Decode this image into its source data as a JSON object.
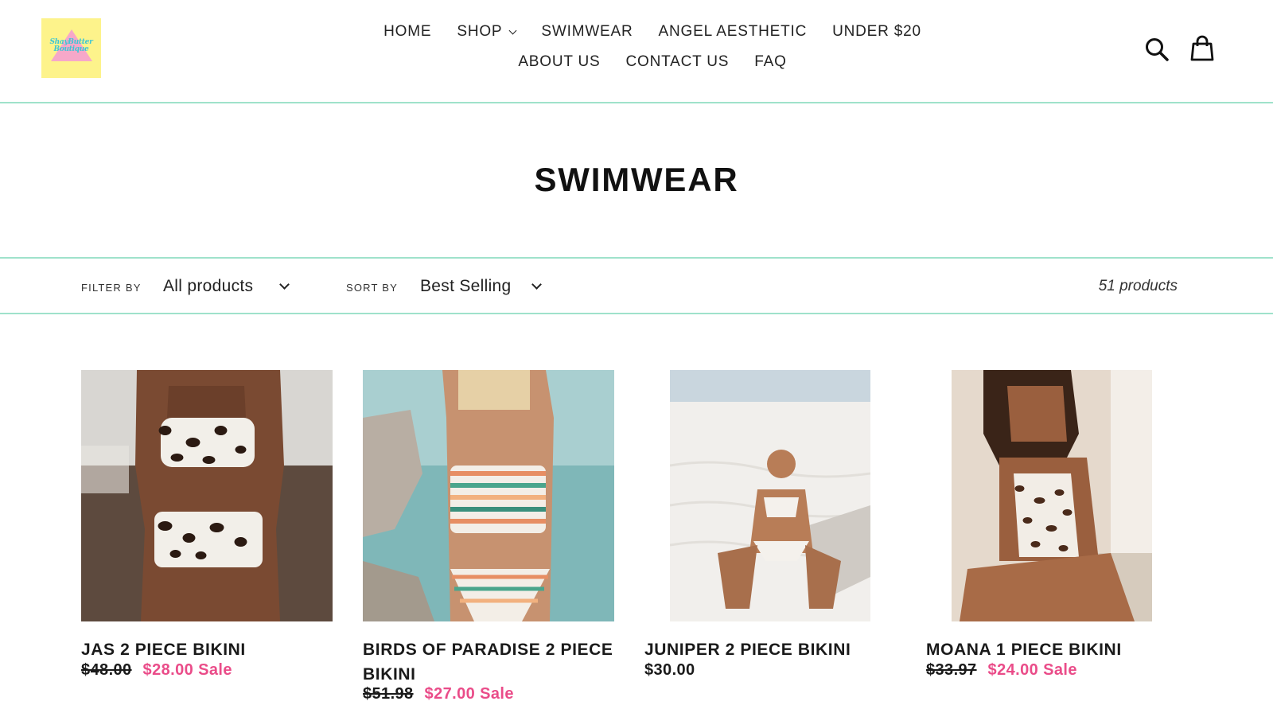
{
  "brand": {
    "logo_text": "ShayButter Boutique",
    "accent_color": "#9fe2cb",
    "sale_color": "#ea4c89"
  },
  "nav": {
    "row1": [
      {
        "label": "HOME"
      },
      {
        "label": "SHOP",
        "dropdown": true
      },
      {
        "label": "SWIMWEAR"
      },
      {
        "label": "ANGEL AESTHETIC"
      },
      {
        "label": "UNDER $20"
      }
    ],
    "row2": [
      {
        "label": "ABOUT US"
      },
      {
        "label": "CONTACT US"
      },
      {
        "label": "FAQ"
      }
    ]
  },
  "header_icons": {
    "search": "search-icon",
    "cart": "cart-icon"
  },
  "page": {
    "title": "SWIMWEAR"
  },
  "filters": {
    "filter_label": "FILTER BY",
    "filter_value": "All products",
    "sort_label": "SORT BY",
    "sort_value": "Best Selling",
    "count": "51 products"
  },
  "products": [
    {
      "title": "JAS 2 PIECE BIKINI",
      "compare_price": "$48.00",
      "price": "$28.00",
      "sale_label": "Sale"
    },
    {
      "title": "BIRDS OF PARADISE 2 PIECE BIKINI",
      "compare_price": "$51.98",
      "price": "$27.00",
      "sale_label": "Sale"
    },
    {
      "title": "JUNIPER 2 PIECE BIKINI",
      "compare_price": "",
      "price": "$30.00",
      "sale_label": ""
    },
    {
      "title": "MOANA 1 PIECE BIKINI",
      "compare_price": "$33.97",
      "price": "$24.00",
      "sale_label": "Sale"
    }
  ]
}
